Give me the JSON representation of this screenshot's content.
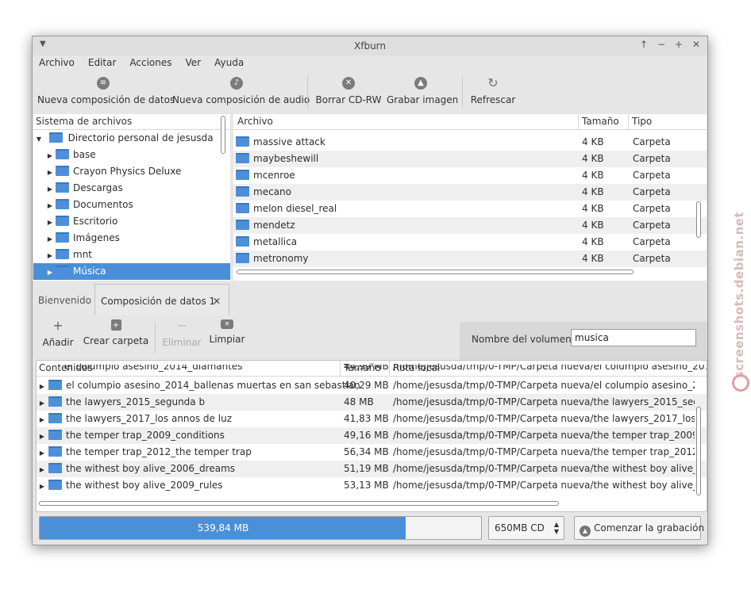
{
  "window": {
    "title": "Xfburn"
  },
  "menu": [
    "Archivo",
    "Editar",
    "Acciones",
    "Ver",
    "Ayuda"
  ],
  "toolbar": {
    "new_data": "Nueva composición de datos",
    "new_audio": "Nueva composición de audio",
    "blank_cd": "Borrar CD-RW",
    "burn_image": "Grabar imagen",
    "refresh": "Refrescar"
  },
  "fs_tree": {
    "header": "Sistema de archivos",
    "root": "Directorio personal de jesusda",
    "items": [
      "base",
      "Crayon Physics Deluxe",
      "Descargas",
      "Documentos",
      "Escritorio",
      "Imágenes",
      "mnt",
      "Música"
    ],
    "selected": "Música"
  },
  "file_list": {
    "headers": [
      "Archivo",
      "Tamaño",
      "Tipo"
    ],
    "rows": [
      {
        "name": "massive attack",
        "size": "4 KB",
        "type": "Carpeta"
      },
      {
        "name": "maybeshewill",
        "size": "4 KB",
        "type": "Carpeta"
      },
      {
        "name": "mcenroe",
        "size": "4 KB",
        "type": "Carpeta"
      },
      {
        "name": "mecano",
        "size": "4 KB",
        "type": "Carpeta"
      },
      {
        "name": "melon diesel_real",
        "size": "4 KB",
        "type": "Carpeta"
      },
      {
        "name": "mendetz",
        "size": "4 KB",
        "type": "Carpeta"
      },
      {
        "name": "metallica",
        "size": "4 KB",
        "type": "Carpeta"
      },
      {
        "name": "metronomy",
        "size": "4 KB",
        "type": "Carpeta"
      }
    ]
  },
  "tabs": {
    "welcome": "Bienvenido",
    "data_comp": "Composición de datos 1"
  },
  "comp_toolbar": {
    "add": "Añadir",
    "new_folder": "Crear carpeta",
    "remove": "Eliminar",
    "clear": "Limpiar",
    "volume_label": "Nombre del volumen:",
    "volume_value": "musica"
  },
  "contents": {
    "headers": [
      "Contenidos",
      "Tamaño",
      "Ruta local"
    ],
    "partial_row": {
      "name": "el columpio asesino_2014_diamantes",
      "size": "44,99 MB",
      "path": "/home/jesusda/tmp/0-TMP/Carpeta nueva/el columpio asesino_2014"
    },
    "rows": [
      {
        "name": "el columpio asesino_2014_ballenas muertas en san sebastian",
        "size": "40,29 MB",
        "path": "/home/jesusda/tmp/0-TMP/Carpeta nueva/el columpio asesino_201"
      },
      {
        "name": "the lawyers_2015_segunda b",
        "size": "48 MB",
        "path": "/home/jesusda/tmp/0-TMP/Carpeta nueva/the lawyers_2015_segun"
      },
      {
        "name": "the lawyers_2017_los annos de luz",
        "size": "41,83 MB",
        "path": "/home/jesusda/tmp/0-TMP/Carpeta nueva/the lawyers_2017_los an"
      },
      {
        "name": "the temper trap_2009_conditions",
        "size": "49,16 MB",
        "path": "/home/jesusda/tmp/0-TMP/Carpeta nueva/the temper trap_2009_co"
      },
      {
        "name": "the temper trap_2012_the temper trap",
        "size": "56,34 MB",
        "path": "/home/jesusda/tmp/0-TMP/Carpeta nueva/the temper trap_2012_th"
      },
      {
        "name": "the withest boy alive_2006_dreams",
        "size": "51,19 MB",
        "path": "/home/jesusda/tmp/0-TMP/Carpeta nueva/the withest boy alive_200"
      },
      {
        "name": "the withest boy alive_2009_rules",
        "size": "53,13 MB",
        "path": "/home/jesusda/tmp/0-TMP/Carpeta nueva/the withest boy alive_200"
      }
    ]
  },
  "status": {
    "used": "539,84 MB",
    "disc": "650MB CD",
    "burn": "Comenzar la grabación",
    "progress_fraction": 0.83
  },
  "watermark": "screenshots.debian.net",
  "colors": {
    "accent": "#4a90d9"
  }
}
